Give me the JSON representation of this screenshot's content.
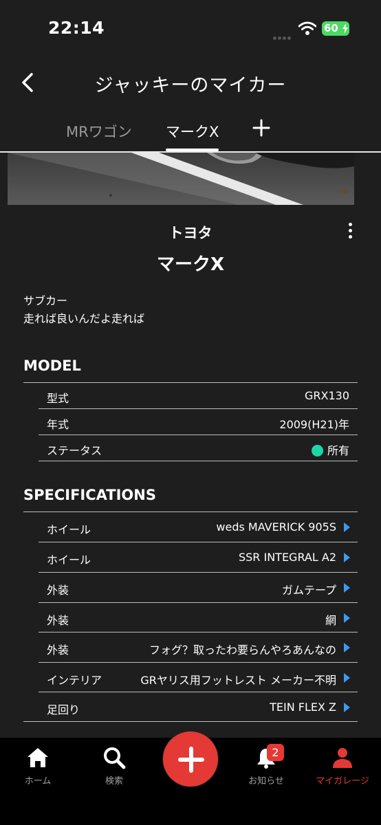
{
  "status_bar": {
    "time": "22:14",
    "battery": "60"
  },
  "header": {
    "title": "ジャッキーのマイカー"
  },
  "tabs": [
    {
      "label": "MRワゴン",
      "active": false
    },
    {
      "label": "マークX",
      "active": true
    }
  ],
  "car": {
    "maker": "トヨタ",
    "model": "マークX",
    "description_lines": [
      "サブカー",
      "走れば良いんだよ走れば"
    ]
  },
  "model_section": {
    "title": "MODEL",
    "rows": [
      {
        "label": "型式",
        "value": "GRX130"
      },
      {
        "label": "年式",
        "value": "2009(H21)年"
      },
      {
        "label": "ステータス",
        "value": "所有",
        "status_color": "#1fd6a8"
      }
    ]
  },
  "specs_section": {
    "title": "SPECIFICATIONS",
    "rows": [
      {
        "label": "ホイール",
        "value": "weds MAVERICK 905S"
      },
      {
        "label": "ホイール",
        "value": "SSR INTEGRAL A2"
      },
      {
        "label": "外装",
        "value": "ガムテープ"
      },
      {
        "label": "外装",
        "value": "網"
      },
      {
        "label": "外装",
        "value": "フォグ？取ったわ要らんやろあんなの"
      },
      {
        "label": "インテリア",
        "value": "GRヤリス用フットレスト メーカー不明"
      },
      {
        "label": "足回り",
        "value": "TEIN FLEX Z"
      }
    ]
  },
  "bottom_nav": {
    "home": "ホーム",
    "search": "検索",
    "notifications": "お知らせ",
    "notification_count": "2",
    "my_garage": "マイガレージ"
  },
  "colors": {
    "accent": "#e53935",
    "link_chevron": "#3b9bf0",
    "status_owned": "#1fd6a8"
  },
  "icons": {
    "back": "chevron-left-icon",
    "add_tab": "plus-icon",
    "more": "more-vertical-icon",
    "home": "home-icon",
    "search": "search-icon",
    "add": "plus-icon",
    "notifications": "bell-icon",
    "my_garage": "person-icon",
    "row_link": "chevron-right-icon"
  }
}
